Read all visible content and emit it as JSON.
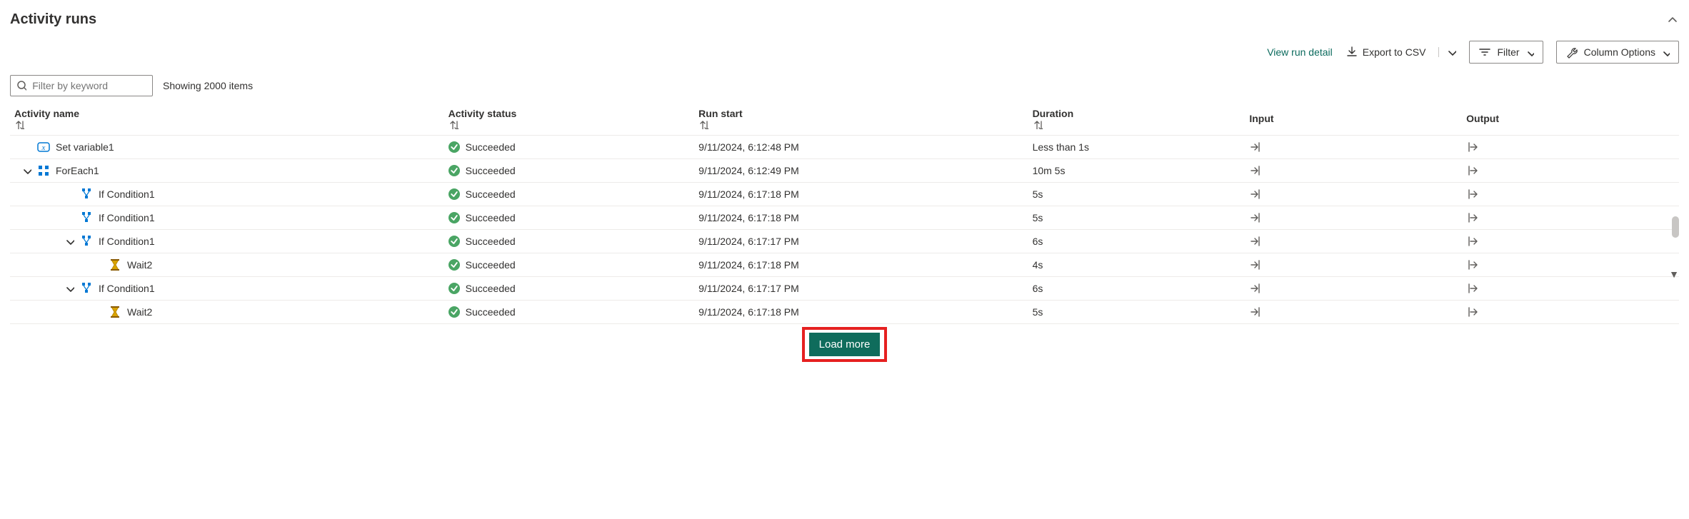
{
  "title": "Activity runs",
  "toolbar": {
    "view_detail": "View run detail",
    "export_csv": "Export to CSV",
    "filter": "Filter",
    "column_options": "Column Options"
  },
  "filter": {
    "placeholder": "Filter by keyword",
    "count_text": "Showing 2000 items"
  },
  "columns": {
    "name": "Activity name",
    "status": "Activity status",
    "start": "Run start",
    "duration": "Duration",
    "input": "Input",
    "output": "Output"
  },
  "rows": [
    {
      "indent": 0,
      "expander": "",
      "icon": "variable",
      "name": "Set variable1",
      "status": "Succeeded",
      "start": "9/11/2024, 6:12:48 PM",
      "duration": "Less than 1s"
    },
    {
      "indent": 1,
      "expander": "down",
      "icon": "foreach",
      "name": "ForEach1",
      "status": "Succeeded",
      "start": "9/11/2024, 6:12:49 PM",
      "duration": "10m 5s"
    },
    {
      "indent": 2,
      "expander": "",
      "icon": "condition",
      "name": "If Condition1",
      "status": "Succeeded",
      "start": "9/11/2024, 6:17:18 PM",
      "duration": "5s"
    },
    {
      "indent": 2,
      "expander": "",
      "icon": "condition",
      "name": "If Condition1",
      "status": "Succeeded",
      "start": "9/11/2024, 6:17:18 PM",
      "duration": "5s"
    },
    {
      "indent": 3,
      "expander": "down",
      "icon": "condition",
      "name": "If Condition1",
      "status": "Succeeded",
      "start": "9/11/2024, 6:17:17 PM",
      "duration": "6s"
    },
    {
      "indent": 4,
      "expander": "",
      "icon": "wait",
      "name": "Wait2",
      "status": "Succeeded",
      "start": "9/11/2024, 6:17:18 PM",
      "duration": "4s"
    },
    {
      "indent": 3,
      "expander": "down",
      "icon": "condition",
      "name": "If Condition1",
      "status": "Succeeded",
      "start": "9/11/2024, 6:17:17 PM",
      "duration": "6s"
    },
    {
      "indent": 4,
      "expander": "",
      "icon": "wait",
      "name": "Wait2",
      "status": "Succeeded",
      "start": "9/11/2024, 6:17:18 PM",
      "duration": "5s"
    }
  ],
  "load_more": "Load more"
}
